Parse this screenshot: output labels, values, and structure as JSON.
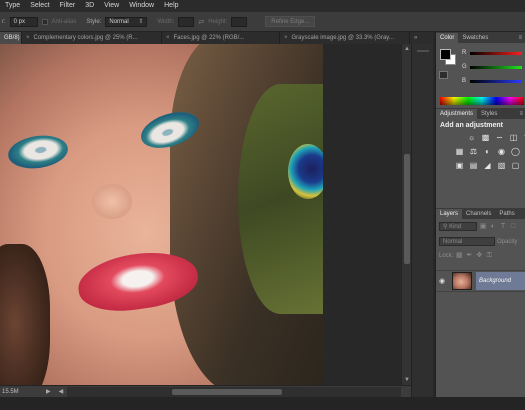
{
  "menubar": {
    "items": [
      {
        "label": "Type"
      },
      {
        "label": "Select"
      },
      {
        "label": "Filter"
      },
      {
        "label": "3D"
      },
      {
        "label": "View"
      },
      {
        "label": "Window"
      },
      {
        "label": "Help"
      }
    ]
  },
  "options": {
    "feather_label": "r:",
    "feather_value": "0 px",
    "antialias_label": "Anti-alias",
    "style_label": "Style:",
    "style_value": "Normal",
    "width_label": "Width:",
    "height_label": "Height:",
    "refine_label": "Refine Edge..."
  },
  "tabs": [
    {
      "label": "GB/8)",
      "active": true
    },
    {
      "label": "Complementary colors.jpg @ 25% (R...",
      "active": false
    },
    {
      "label": "Faces.jpg @ 22% (RGB/...",
      "active": false
    },
    {
      "label": "Grayscale image.jpg @ 33.3% (Gray...",
      "active": false
    }
  ],
  "status": {
    "doc_size": "15.5M"
  },
  "panels": {
    "color": {
      "tabs": [
        "Color",
        "Swatches"
      ],
      "channels": [
        "R",
        "G",
        "B"
      ],
      "fg_color": "#000000",
      "bg_color": "#ffffff"
    },
    "adjustments": {
      "tabs": [
        "Adjustments",
        "Styles"
      ],
      "title": "Add an adjustment"
    },
    "layers": {
      "tabs": [
        "Layers",
        "Channels",
        "Paths"
      ],
      "filter_label": "Kind",
      "blend_mode": "Normal",
      "opacity_label": "Opacity",
      "lock_label": "Lock:",
      "layer_name": "Background"
    }
  }
}
